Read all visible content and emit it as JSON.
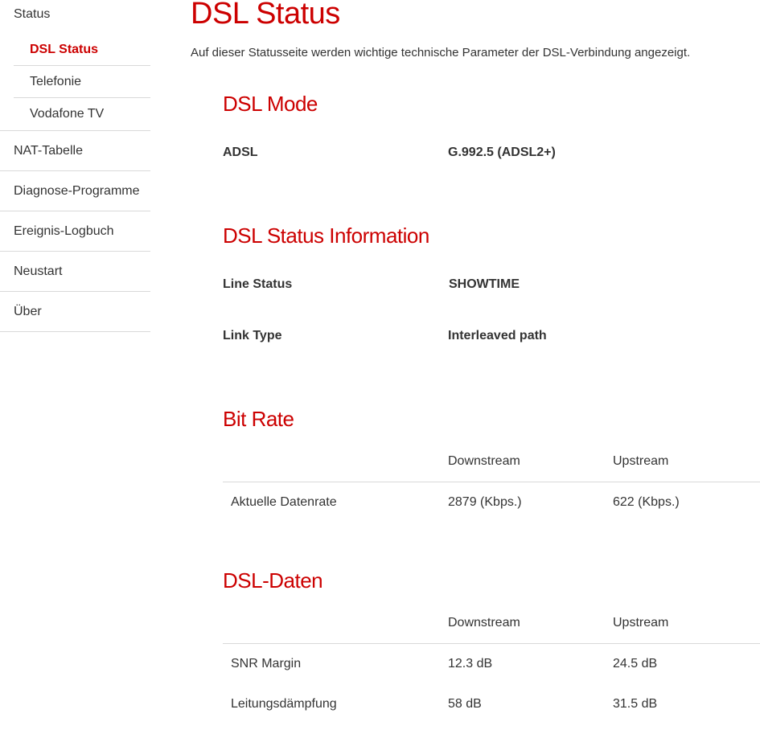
{
  "sidebar": {
    "status": "Status",
    "sub_items": [
      {
        "label": "DSL Status",
        "active": true
      },
      {
        "label": "Telefonie",
        "active": false
      },
      {
        "label": "Vodafone TV",
        "active": false
      }
    ],
    "items": [
      "NAT-Tabelle",
      "Diagnose-Programme",
      "Ereignis-Logbuch",
      "Neustart",
      "Über"
    ]
  },
  "page": {
    "title": "DSL Status",
    "intro": "Auf dieser Statusseite werden wichtige technische Parameter der DSL-Verbindung angezeigt."
  },
  "dsl_mode": {
    "title": "DSL Mode",
    "label": "ADSL",
    "value": "G.992.5 (ADSL2+)"
  },
  "status_info": {
    "title": "DSL Status Information",
    "line_status_label": "Line Status",
    "line_status_value": "SHOWTIME",
    "link_type_label": "Link Type",
    "link_type_value": "Interleaved path"
  },
  "bit_rate": {
    "title": "Bit Rate",
    "headers": [
      "",
      "Downstream",
      "Upstream"
    ],
    "rows": [
      [
        "Aktuelle Datenrate",
        "2879 (Kbps.)",
        "622 (Kbps.)"
      ]
    ]
  },
  "dsl_daten": {
    "title": "DSL-Daten",
    "headers": [
      "",
      "Downstream",
      "Upstream"
    ],
    "rows": [
      [
        "SNR Margin",
        "12.3 dB",
        "24.5 dB"
      ],
      [
        "Leitungsdämpfung",
        "58 dB",
        "31.5 dB"
      ]
    ]
  },
  "colors": {
    "accent": "#cc0000",
    "text": "#333333",
    "divider": "#d9d9d9"
  }
}
